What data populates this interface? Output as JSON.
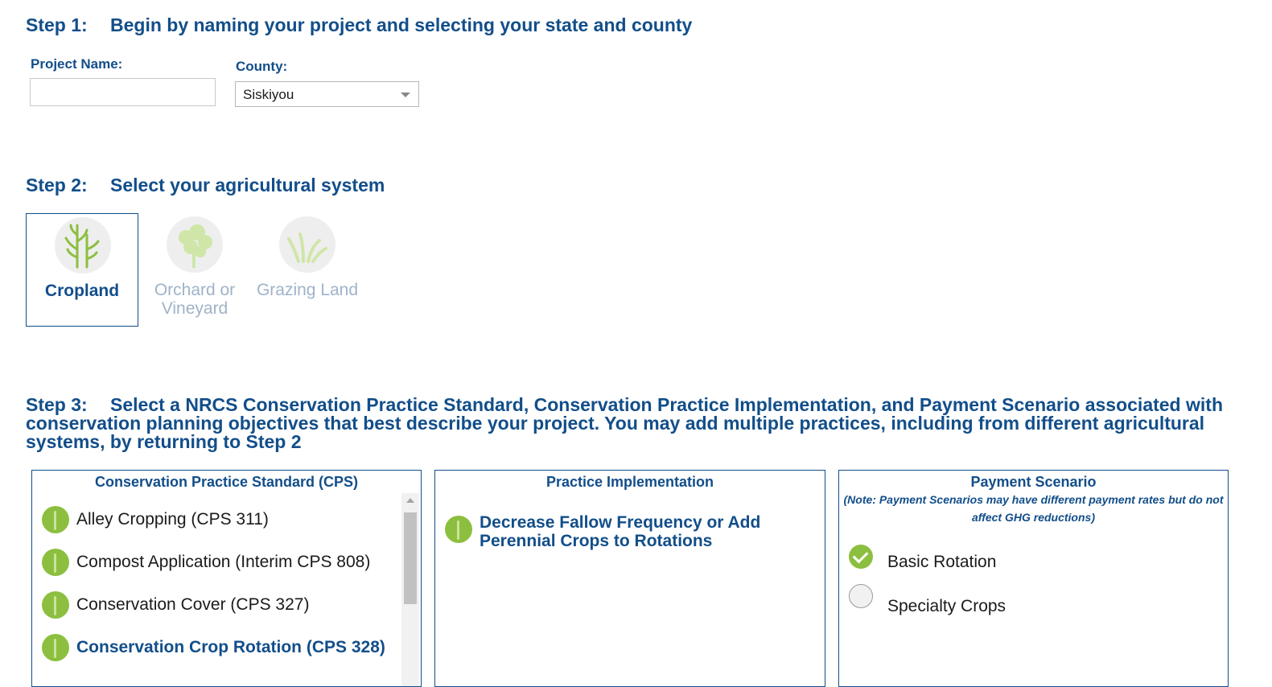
{
  "step1": {
    "num": "Step 1:",
    "title": "Begin by naming your project and selecting your state and county",
    "project_label": "Project Name:",
    "project_value": "",
    "county_label": "County:",
    "county_value": "Siskiyou"
  },
  "step2": {
    "num": "Step 2:",
    "title": "Select your agricultural system",
    "systems": [
      {
        "label": "Cropland",
        "icon": "cropland-icon",
        "selected": true
      },
      {
        "label": "Orchard or Vineyard",
        "icon": "orchard-icon",
        "selected": false
      },
      {
        "label": "Grazing Land",
        "icon": "grazing-icon",
        "selected": false
      }
    ]
  },
  "step3": {
    "num": "Step 3:",
    "title": "Select a NRCS Conservation Practice Standard, Conservation Practice Implementation, and Payment Scenario associated with conservation planning objectives that best describe your project. You may add multiple practices, including from different agricultural systems, by returning to Step 2"
  },
  "cps_panel": {
    "header": "Conservation Practice Standard (CPS)",
    "items": [
      {
        "label": "Alley Cropping (CPS 311)",
        "active": false
      },
      {
        "label": "Compost Application (Interim CPS 808)",
        "active": false
      },
      {
        "label": "Conservation Cover (CPS 327)",
        "active": false
      },
      {
        "label": "Conservation Crop Rotation (CPS 328)",
        "active": true
      }
    ]
  },
  "impl_panel": {
    "header": "Practice Implementation",
    "items": [
      {
        "label": "Decrease Fallow Frequency or Add Perennial Crops to Rotations"
      }
    ]
  },
  "payment_panel": {
    "header": "Payment Scenario",
    "note": "(Note: Payment Scenarios may have different payment rates but do not affect GHG reductions)",
    "options": [
      {
        "label": "Basic Rotation",
        "checked": true
      },
      {
        "label": "Specialty Crops",
        "checked": false
      }
    ]
  },
  "colors": {
    "brand": "#124e8a",
    "accent": "#8cbf3f",
    "disabled": "#9fb3c8"
  }
}
